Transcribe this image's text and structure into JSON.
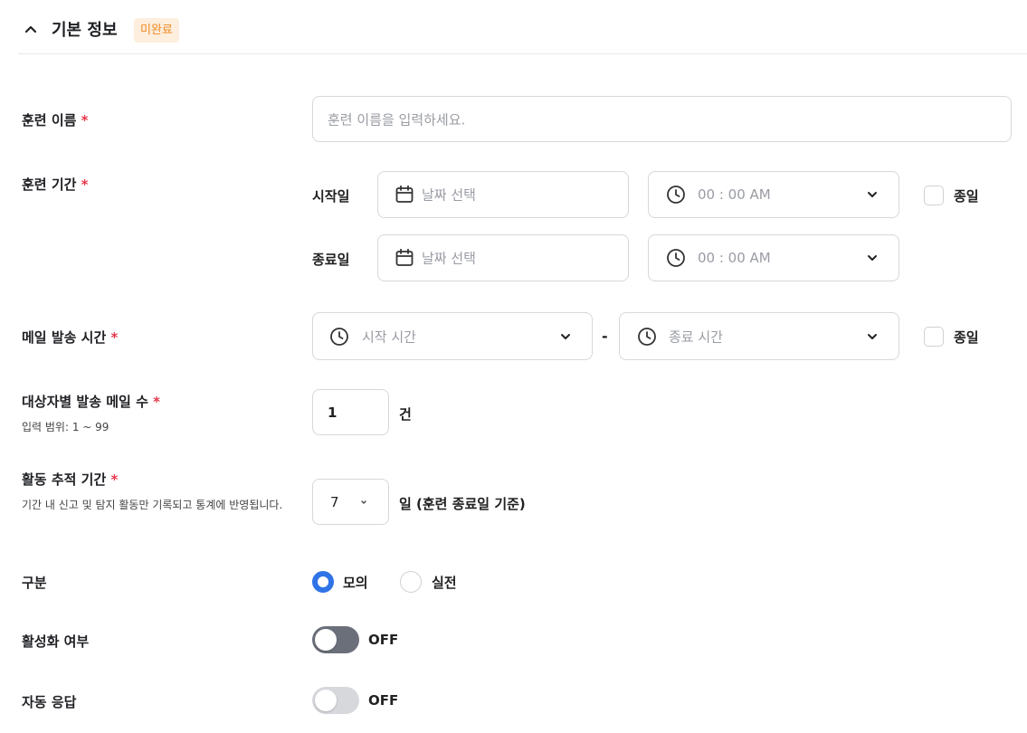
{
  "section": {
    "title": "기본 정보",
    "badge": "미완료"
  },
  "fields": {
    "name": {
      "label": "훈련 이름",
      "required": "*",
      "placeholder": "훈련 이름을 입력하세요."
    },
    "period": {
      "label": "훈련 기간",
      "required": "*",
      "start_label": "시작일",
      "end_label": "종료일",
      "date_placeholder": "날짜 선택",
      "time_placeholder": "00 : 00 AM",
      "allday_label": "종일"
    },
    "mail_time": {
      "label": "메일 발송 시간",
      "required": "*",
      "start_placeholder": "시작 시간",
      "separator": "-",
      "end_placeholder": "종료 시간",
      "allday_label": "종일"
    },
    "mail_count": {
      "label": "대상자별 발송 메일 수",
      "required": "*",
      "hint": "입력 범위: 1 ~ 99",
      "value": "1",
      "unit": "건"
    },
    "tracking": {
      "label": "활동 추적 기간",
      "required": "*",
      "hint": "기간 내 신고 및 탐지 활동만 기록되고 통계에 반영됩니다.",
      "value": "7",
      "unit": "일 (훈련 종료일 기준)"
    },
    "type": {
      "label": "구분",
      "options": [
        "모의",
        "실전"
      ],
      "selected": "모의"
    },
    "active": {
      "label": "활성화 여부",
      "state": "OFF"
    },
    "auto_reply": {
      "label": "자동 응답",
      "state": "OFF"
    }
  },
  "colors": {
    "accent": "#2f74e6",
    "required": "#e5384a",
    "badge_bg": "#fdeedd",
    "badge_text": "#f08a24",
    "toggle_dark": "#6b6f7a",
    "toggle_light": "#d6d8dc"
  }
}
